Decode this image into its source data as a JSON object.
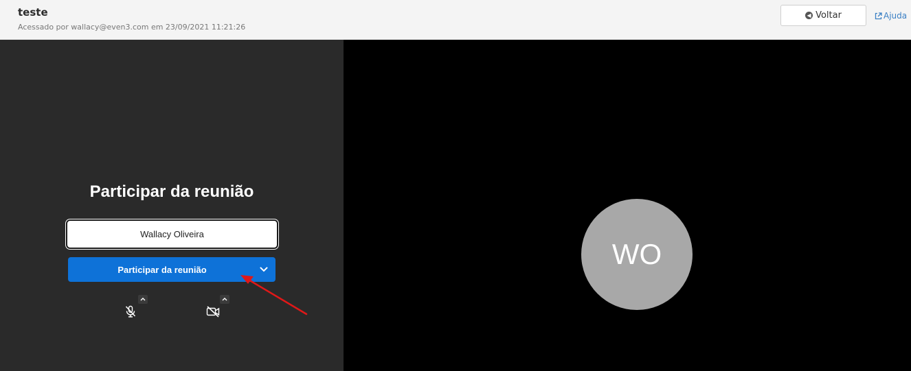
{
  "header": {
    "title": "teste",
    "subtitle": "Acessado por wallacy@even3.com em 23/09/2021 11:21:26",
    "back_label": "Voltar",
    "help_label": "Ajuda"
  },
  "join": {
    "heading": "Participar da reunião",
    "name_value": "Wallacy Oliveira",
    "button_label": "Participar da reunião"
  },
  "media": {
    "mic_icon": "mic-muted-icon",
    "camera_icon": "camera-off-icon"
  },
  "preview": {
    "avatar_initials": "WO"
  },
  "colors": {
    "accent": "#0e72d8",
    "left_panel": "#2a2a2a",
    "right_panel": "#000000",
    "avatar": "#a8a8a8",
    "annotation": "#e01818"
  }
}
